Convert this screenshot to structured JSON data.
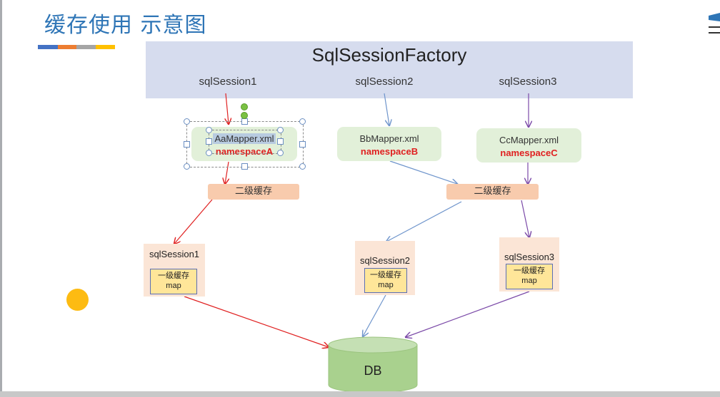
{
  "title": "缓存使用 示意图",
  "factory": {
    "label": "SqlSessionFactory"
  },
  "sessions_top": [
    "sqlSession1",
    "sqlSession2",
    "sqlSession3"
  ],
  "mappers": [
    {
      "file": "AaMapper.xml",
      "namespace": "namespaceA"
    },
    {
      "file": "BbMapper.xml",
      "namespace": "namespaceB"
    },
    {
      "file": "CcMapper.xml",
      "namespace": "namespaceC"
    }
  ],
  "cache_level2": "二级缓存",
  "sessions_bottom": [
    {
      "name": "sqlSession1",
      "cache_label": "一级缓存",
      "cache_type": "map"
    },
    {
      "name": "sqlSession2",
      "cache_label": "一级缓存",
      "cache_type": "map"
    },
    {
      "name": "sqlSession3",
      "cache_label": "一级缓存",
      "cache_type": "map"
    }
  ],
  "db": {
    "label": "DB"
  },
  "colors": {
    "title": "#2e75b6",
    "bar": [
      "#4472c4",
      "#ed7d31",
      "#a5a5a5",
      "#ffc000"
    ],
    "arrow_red": "#e02020",
    "arrow_blue": "#6f95cc",
    "arrow_purple": "#7b4aa8",
    "db_fill": "#a9d18e",
    "db_top": "#c5e0b4"
  }
}
